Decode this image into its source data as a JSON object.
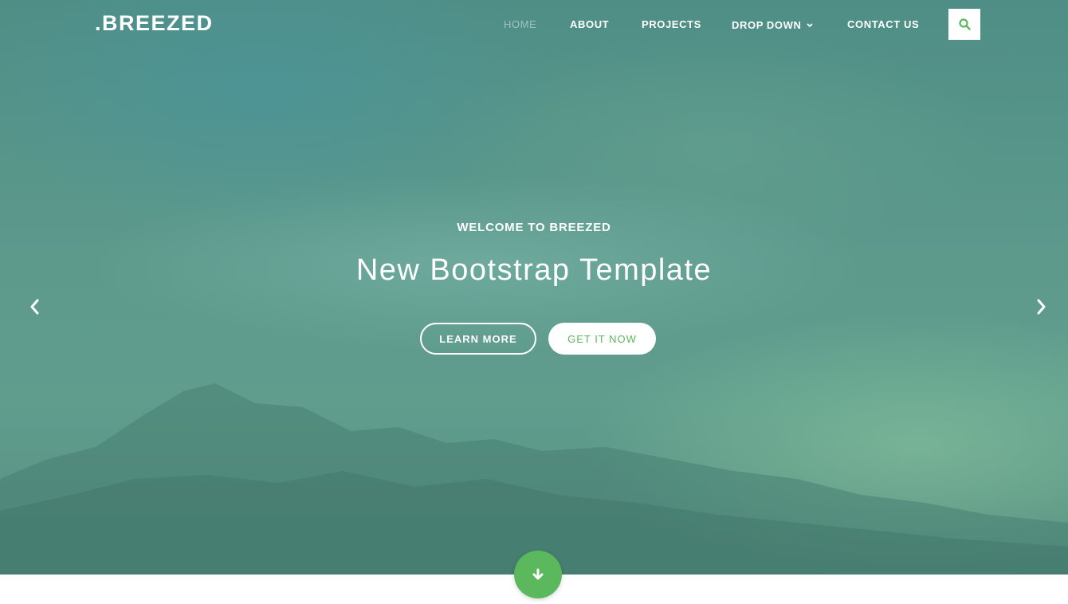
{
  "brand": {
    "logo_text": ".BREEZED"
  },
  "nav": {
    "items": [
      {
        "label": "HOME",
        "active": true
      },
      {
        "label": "ABOUT"
      },
      {
        "label": "PROJECTS"
      },
      {
        "label": "DROP DOWN",
        "has_dropdown": true
      },
      {
        "label": "CONTACT US"
      }
    ],
    "search_icon": "search-icon"
  },
  "hero": {
    "subtitle": "WELCOME TO BREEZED",
    "title": "New Bootstrap Template",
    "buttons": {
      "learn_more": "LEARN MORE",
      "get_it_now": "GET IT NOW"
    },
    "prev_icon": "chevron-left-icon",
    "next_icon": "chevron-right-icon",
    "scroll_icon": "arrow-down-icon"
  },
  "colors": {
    "accent": "#5cb85c",
    "nav_active": "#9ec4bf",
    "text_light": "#ffffff"
  }
}
